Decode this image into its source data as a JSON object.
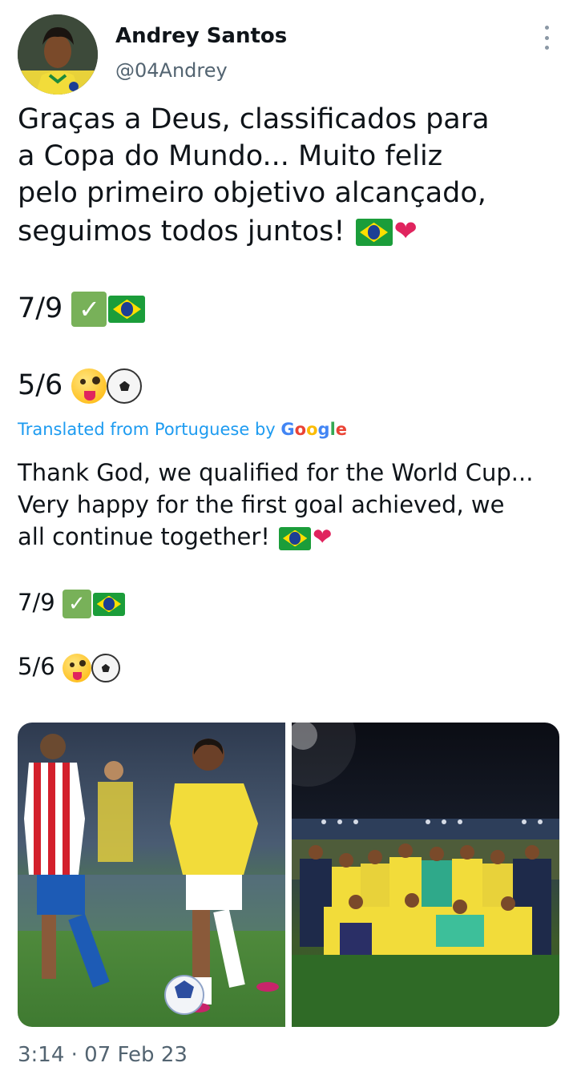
{
  "author": {
    "name": "Andrey Santos",
    "handle": "@04Andrey"
  },
  "tweet": {
    "lines": [
      "Graças a Deus, classificados para",
      "a Copa do Mundo...  Muito feliz",
      "pelo primeiro objetivo alcançado,",
      "seguimos todos juntos!"
    ],
    "stat1": "7/9",
    "stat2": "5/6"
  },
  "translation": {
    "label": "Translated from Portuguese by",
    "provider": "Google",
    "lines": [
      "Thank God, we qualified for the World Cup...",
      "Very happy for the first goal achieved, we",
      "all continue together!"
    ],
    "stat1": "7/9",
    "stat2": "5/6"
  },
  "media": {
    "photo1_description": "photo-player-dribbling",
    "photo2_description": "photo-team-celebration"
  },
  "timestamp": "3:14 · 07 Feb 23",
  "icons": {
    "more": "more-vertical-icon",
    "flag": "brazil-flag-icon",
    "heart": "red-heart-icon",
    "check": "check-mark-icon",
    "face": "zany-face-icon",
    "ball": "soccer-ball-icon"
  },
  "colors": {
    "text": "#0f1419",
    "secondary": "#536471",
    "link": "#1d9bf0",
    "heart": "#e0245e"
  }
}
